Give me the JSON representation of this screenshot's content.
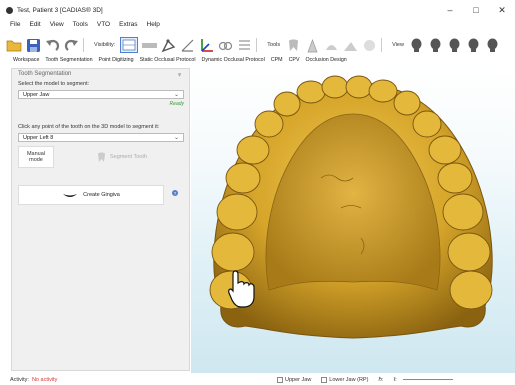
{
  "titlebar": {
    "title": "Test, Patient 3 [CADIAS® 3D]",
    "buttons": {
      "minimize": "–",
      "maximize": "□",
      "close": "✕"
    }
  },
  "menu": {
    "items": [
      "File",
      "Edit",
      "View",
      "Tools",
      "VTO",
      "Extras",
      "Help"
    ]
  },
  "toolbar": {
    "visibility_label": "Visibility:",
    "tools_label": "Tools",
    "view_label": "View"
  },
  "tabs": [
    "Workspace",
    "Tooth Segmentation",
    "Point Digitizing",
    "Static Occlusal Protocol",
    "Dynamic Occlusal Protocol",
    "CPM",
    "CPV",
    "Occlusion Design"
  ],
  "panel": {
    "title": "Tooth Segmentation",
    "pin": "ᵩ",
    "model_label": "Select the model to segment:",
    "model_value": "Upper Jaw",
    "status": "Ready",
    "tooth_label": "Click any point of the tooth on the 3D model to segment it:",
    "tooth_value": "Upper Left 8",
    "manual_line1": "Manual",
    "manual_line2": "mode",
    "segment_label": "Segment Tooth",
    "create_label": "Create Gingiva",
    "help": "?"
  },
  "status": {
    "activity_label": "Activity:",
    "activity_value": "No activity",
    "upper_jaw": "Upper Jaw",
    "lower_jaw": "Lower Jaw (RP)",
    "zoom_label": "ℏ:",
    "rot_label": "ℓ:"
  },
  "colors": {
    "accent": "#4f7fce",
    "model_gold": "#d6a92c",
    "status_error": "#dd3333",
    "status_ok": "#3a9a3a"
  }
}
